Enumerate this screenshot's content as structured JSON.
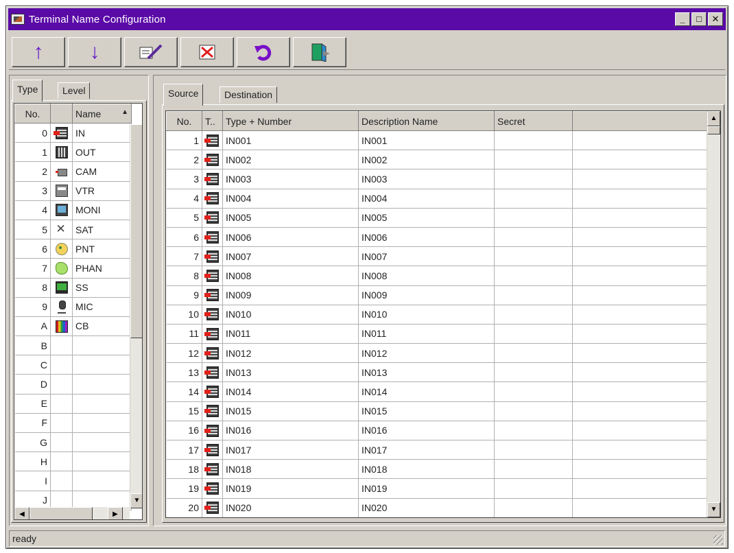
{
  "window": {
    "title": "Terminal Name Configuration",
    "minimize": "_",
    "maximize": "□",
    "close": "✕"
  },
  "toolbar": {
    "up": "↑",
    "down": "↓",
    "edit": "✎",
    "delete": "☒",
    "undo": "↶",
    "exit": "⇥"
  },
  "left_tabs": [
    "Type",
    "Level"
  ],
  "left_headers": {
    "no": "No.",
    "name": "Name"
  },
  "types": [
    {
      "no": "0",
      "icon": "in",
      "name": "IN"
    },
    {
      "no": "1",
      "icon": "out",
      "name": "OUT"
    },
    {
      "no": "2",
      "icon": "cam",
      "name": "CAM"
    },
    {
      "no": "3",
      "icon": "vtr",
      "name": "VTR"
    },
    {
      "no": "4",
      "icon": "moni",
      "name": "MONI"
    },
    {
      "no": "5",
      "icon": "sat",
      "name": "SAT"
    },
    {
      "no": "6",
      "icon": "pnt",
      "name": "PNT"
    },
    {
      "no": "7",
      "icon": "phan",
      "name": "PHAN"
    },
    {
      "no": "8",
      "icon": "ss",
      "name": "SS"
    },
    {
      "no": "9",
      "icon": "mic",
      "name": "MIC"
    },
    {
      "no": "A",
      "icon": "cb",
      "name": "CB"
    },
    {
      "no": "B",
      "icon": "",
      "name": ""
    },
    {
      "no": "C",
      "icon": "",
      "name": ""
    },
    {
      "no": "D",
      "icon": "",
      "name": ""
    },
    {
      "no": "E",
      "icon": "",
      "name": ""
    },
    {
      "no": "F",
      "icon": "",
      "name": ""
    },
    {
      "no": "G",
      "icon": "",
      "name": ""
    },
    {
      "no": "H",
      "icon": "",
      "name": ""
    },
    {
      "no": "I",
      "icon": "",
      "name": ""
    },
    {
      "no": "J",
      "icon": "",
      "name": ""
    }
  ],
  "right_tabs": [
    "Source",
    "Destination"
  ],
  "right_headers": {
    "no": "No.",
    "type": "T..",
    "type_number": "Type + Number",
    "description": "Description Name",
    "secret": "Secret"
  },
  "sources": [
    {
      "no": "1",
      "type_number": "IN001",
      "description": "IN001",
      "secret": ""
    },
    {
      "no": "2",
      "type_number": "IN002",
      "description": "IN002",
      "secret": ""
    },
    {
      "no": "3",
      "type_number": "IN003",
      "description": "IN003",
      "secret": ""
    },
    {
      "no": "4",
      "type_number": "IN004",
      "description": "IN004",
      "secret": ""
    },
    {
      "no": "5",
      "type_number": "IN005",
      "description": "IN005",
      "secret": ""
    },
    {
      "no": "6",
      "type_number": "IN006",
      "description": "IN006",
      "secret": ""
    },
    {
      "no": "7",
      "type_number": "IN007",
      "description": "IN007",
      "secret": ""
    },
    {
      "no": "8",
      "type_number": "IN008",
      "description": "IN008",
      "secret": ""
    },
    {
      "no": "9",
      "type_number": "IN009",
      "description": "IN009",
      "secret": ""
    },
    {
      "no": "10",
      "type_number": "IN010",
      "description": "IN010",
      "secret": ""
    },
    {
      "no": "11",
      "type_number": "IN011",
      "description": "IN011",
      "secret": ""
    },
    {
      "no": "12",
      "type_number": "IN012",
      "description": "IN012",
      "secret": ""
    },
    {
      "no": "13",
      "type_number": "IN013",
      "description": "IN013",
      "secret": ""
    },
    {
      "no": "14",
      "type_number": "IN014",
      "description": "IN014",
      "secret": ""
    },
    {
      "no": "15",
      "type_number": "IN015",
      "description": "IN015",
      "secret": ""
    },
    {
      "no": "16",
      "type_number": "IN016",
      "description": "IN016",
      "secret": ""
    },
    {
      "no": "17",
      "type_number": "IN017",
      "description": "IN017",
      "secret": ""
    },
    {
      "no": "18",
      "type_number": "IN018",
      "description": "IN018",
      "secret": ""
    },
    {
      "no": "19",
      "type_number": "IN019",
      "description": "IN019",
      "secret": ""
    },
    {
      "no": "20",
      "type_number": "IN020",
      "description": "IN020",
      "secret": ""
    }
  ],
  "scroll": {
    "up": "▲",
    "down": "▼",
    "left": "◀",
    "right": "▶"
  },
  "status": {
    "text": "ready"
  },
  "colors": {
    "titlebar": "#5a0aa6",
    "face": "#d4d0c8"
  }
}
